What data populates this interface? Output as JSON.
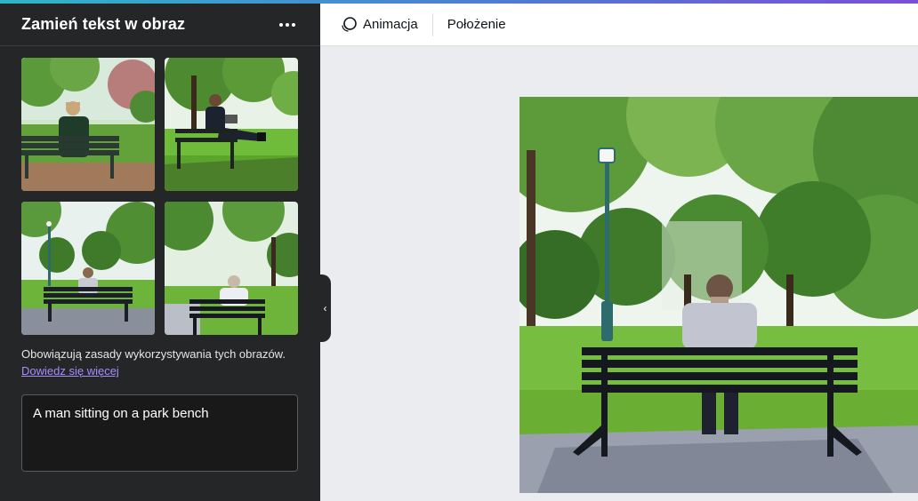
{
  "panel": {
    "title": "Zamień tekst w obraz",
    "more_icon": "more-horizontal-icon",
    "terms_text": "Obowiązują zasady wykorzystywania tych obrazów.",
    "learn_more": "Dowiedz się więcej",
    "prompt_value": "A man sitting on a park bench",
    "collapse_icon": "chevron-left-icon"
  },
  "toolbar": {
    "animation_label": "Animacja",
    "position_label": "Położenie"
  },
  "colors": {
    "panel_bg": "#252627",
    "link": "#a98bff",
    "canvas_bg": "#ebecf0",
    "grass": "#6fae3a",
    "foliage": "#3f7d2a"
  }
}
